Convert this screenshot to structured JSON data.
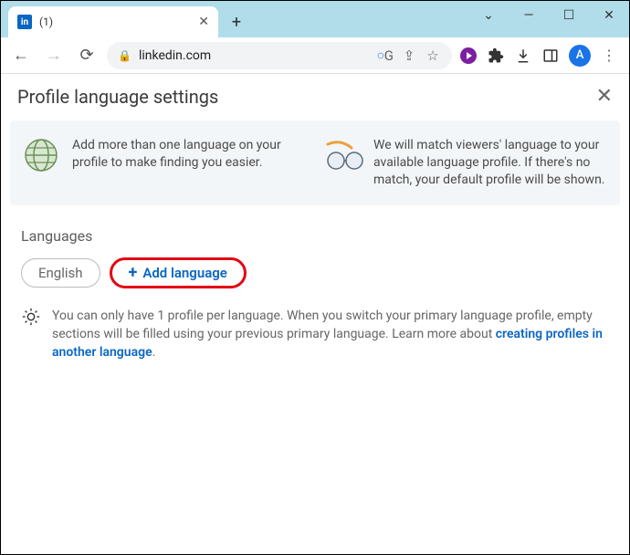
{
  "browser": {
    "tab_title": "(1)",
    "url": "linkedin.com",
    "avatar_initial": "A"
  },
  "page": {
    "title": "Profile language settings",
    "info_left": "Add more than one language on your profile to make finding you easier.",
    "info_right": "We will match viewers' language to your available language profile. If there's no match, your default profile will be shown.",
    "section_title": "Languages",
    "language_pill": "English",
    "add_language_label": "Add language",
    "tip_text_1": "You can only have 1 profile per language. When you switch your primary language profile, empty sections will be filled using your previous primary language. Learn more about ",
    "tip_link": "creating profiles in another language",
    "tip_text_2": "."
  }
}
